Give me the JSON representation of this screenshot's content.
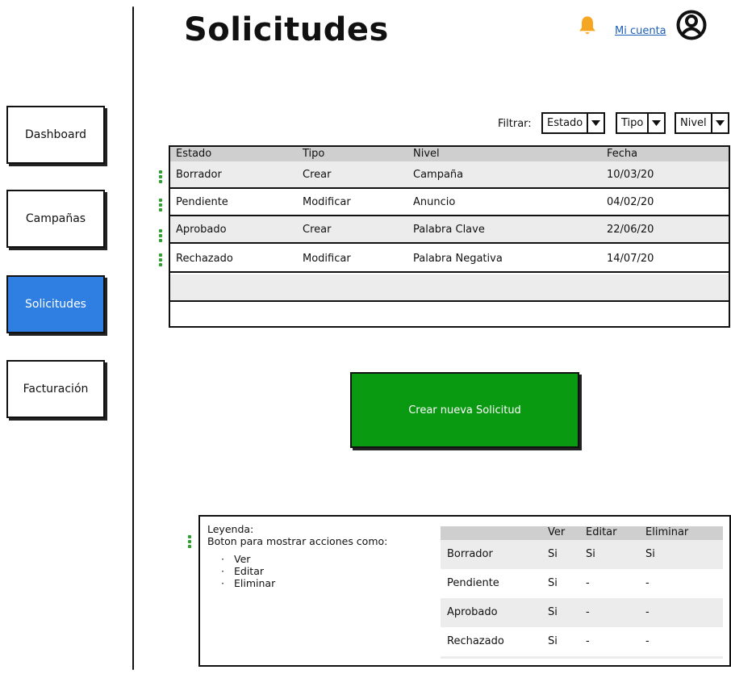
{
  "header": {
    "title": "Solicitudes",
    "account_link": "Mi cuenta"
  },
  "icons": {
    "notifications": "bell-icon",
    "account": "user-circle-icon",
    "dropdown": "caret-down-icon",
    "row_actions": "kebab-menu-icon"
  },
  "colors": {
    "active_nav": "#2f7fe3",
    "create_button": "#0a9a12",
    "link": "#1d5fb5",
    "notification": "#f5a623",
    "actions_marker": "#2ca02c",
    "table_header": "#cfcfcf"
  },
  "sidebar": {
    "items": [
      {
        "label": "Dashboard",
        "active": false
      },
      {
        "label": "Campañas",
        "active": false
      },
      {
        "label": "Solicitudes",
        "active": true
      },
      {
        "label": "Facturación",
        "active": false
      }
    ]
  },
  "filters": {
    "label": "Filtrar:",
    "estado": "Estado",
    "tipo": "Tipo",
    "nivel": "Nivel"
  },
  "table": {
    "columns": [
      "Estado",
      "Tipo",
      "Nivel",
      "Fecha"
    ],
    "rows": [
      [
        "Borrador",
        "Crear",
        "Campaña",
        "10/03/20"
      ],
      [
        "Pendiente",
        "Modificar",
        "Anuncio",
        "04/02/20"
      ],
      [
        "Aprobado",
        "Crear",
        "Palabra Clave",
        "22/06/20"
      ],
      [
        "Rechazado",
        "Modificar",
        "Palabra Negativa",
        "14/07/20"
      ]
    ]
  },
  "create_button": "Crear nueva Solicitud",
  "legend": {
    "title": "Leyenda:",
    "description": "Boton para mostrar acciones como:",
    "actions": [
      "Ver",
      "Editar",
      "Eliminar"
    ],
    "table": {
      "columns": [
        "",
        "Ver",
        "Editar",
        "Eliminar"
      ],
      "rows": [
        [
          "Borrador",
          "Si",
          "Si",
          "Si"
        ],
        [
          "Pendiente",
          "Si",
          "-",
          "-"
        ],
        [
          "Aprobado",
          "Si",
          "-",
          "-"
        ],
        [
          "Rechazado",
          "Si",
          "-",
          "-"
        ]
      ]
    }
  }
}
